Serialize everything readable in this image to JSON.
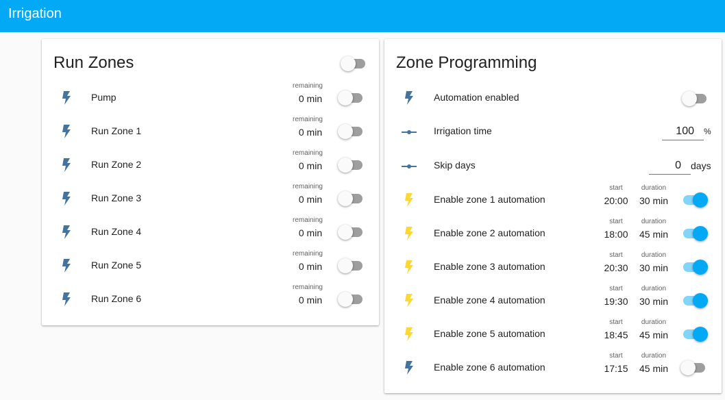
{
  "app": {
    "title": "Irrigation"
  },
  "colors": {
    "header": "#03a9f4",
    "bolt_off": "#44739e",
    "bolt_on": "#fdd835",
    "toggle_on": "#03a9f4"
  },
  "run_zones": {
    "title": "Run Zones",
    "master_toggle_on": false,
    "remaining_label": "remaining",
    "rows": [
      {
        "label": "Pump",
        "remaining": "0 min",
        "on": false
      },
      {
        "label": "Run Zone 1",
        "remaining": "0 min",
        "on": false
      },
      {
        "label": "Run Zone 2",
        "remaining": "0 min",
        "on": false
      },
      {
        "label": "Run Zone 3",
        "remaining": "0 min",
        "on": false
      },
      {
        "label": "Run Zone 4",
        "remaining": "0 min",
        "on": false
      },
      {
        "label": "Run Zone 5",
        "remaining": "0 min",
        "on": false
      },
      {
        "label": "Run Zone 6",
        "remaining": "0 min",
        "on": false
      }
    ]
  },
  "zone_programming": {
    "title": "Zone Programming",
    "automation": {
      "label": "Automation enabled",
      "on": false
    },
    "irrigation_time": {
      "label": "Irrigation time",
      "value": "100",
      "unit": "%"
    },
    "skip_days": {
      "label": "Skip days",
      "value": "0",
      "unit": "days"
    },
    "start_label": "start",
    "duration_label": "duration",
    "zones": [
      {
        "label": "Enable zone 1 automation",
        "start": "20:00",
        "duration": "30 min",
        "on": true
      },
      {
        "label": "Enable zone 2 automation",
        "start": "18:00",
        "duration": "45 min",
        "on": true
      },
      {
        "label": "Enable zone 3 automation",
        "start": "20:30",
        "duration": "30 min",
        "on": true
      },
      {
        "label": "Enable zone 4 automation",
        "start": "19:30",
        "duration": "30 min",
        "on": true
      },
      {
        "label": "Enable zone 5 automation",
        "start": "18:45",
        "duration": "45 min",
        "on": true
      },
      {
        "label": "Enable zone 6 automation",
        "start": "17:15",
        "duration": "45 min",
        "on": false
      }
    ]
  }
}
